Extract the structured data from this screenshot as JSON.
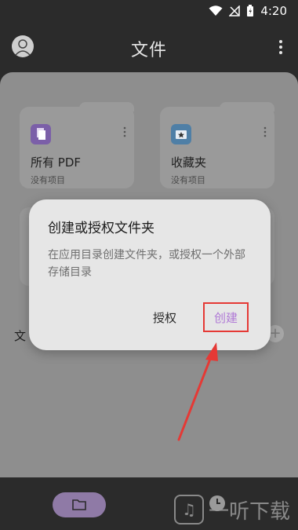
{
  "status_bar": {
    "time": "4:20",
    "icons": [
      "wifi-icon",
      "signal-icon",
      "battery-icon"
    ]
  },
  "app_bar": {
    "title": "文件",
    "left_icon": "avatar-icon",
    "right_icon": "more-vert-icon"
  },
  "cards": [
    {
      "name": "所有 PDF",
      "subtitle": "没有项目",
      "icon": "pdf-icon",
      "icon_color": "#7b5fa8"
    },
    {
      "name": "收藏夹",
      "subtitle": "没有项目",
      "icon": "star-folder-icon",
      "icon_color": "#4f7fa6"
    }
  ],
  "section": {
    "label": "文",
    "add_icon": "plus-icon"
  },
  "dialog": {
    "title": "创建或授权文件夹",
    "body": "在应用目录创建文件夹，或授权一个外部存储目录",
    "authorize_label": "授权",
    "create_label": "创建",
    "highlight_color": "#e53935"
  },
  "bottom_nav": {
    "items": [
      "folder-icon",
      "recent-icon"
    ],
    "active": "folder-icon"
  },
  "watermark": {
    "text": "一听下载"
  },
  "colors": {
    "scrim": "#8e8e8e",
    "dark_bar": "#2b2b2b",
    "accent": "#b07ad6",
    "arrow": "#e53935"
  }
}
